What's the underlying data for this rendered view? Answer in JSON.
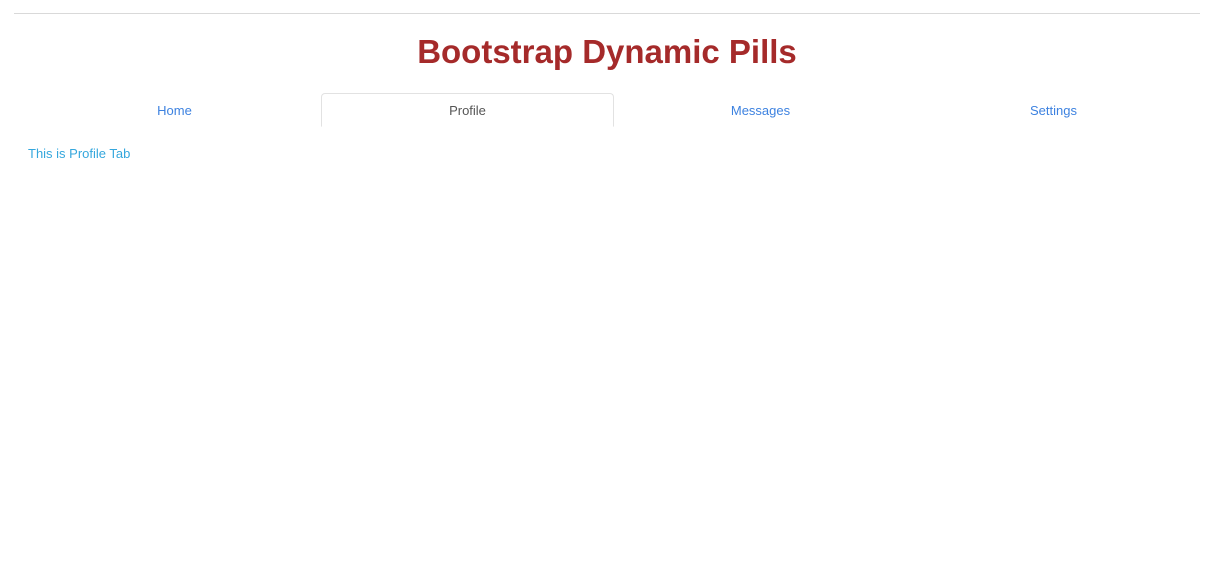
{
  "header": {
    "title": "Bootstrap Dynamic Pills"
  },
  "tabs": [
    {
      "label": "Home",
      "active": false
    },
    {
      "label": "Profile",
      "active": true
    },
    {
      "label": "Messages",
      "active": false
    },
    {
      "label": "Settings",
      "active": false
    }
  ],
  "content": {
    "text": "This is Profile Tab"
  },
  "colors": {
    "title": "#a52a2a",
    "tab_link": "#3d82e0",
    "tab_active_text": "#555555",
    "content_text": "#35a7dd"
  }
}
